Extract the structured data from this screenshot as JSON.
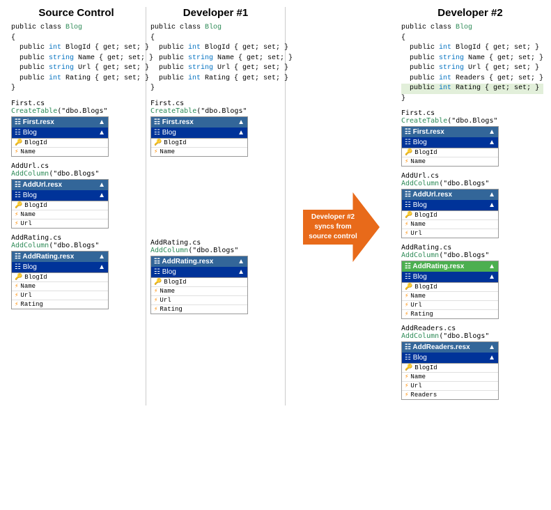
{
  "columns": {
    "source_control": {
      "title": "Source Control",
      "code": {
        "lines": [
          {
            "text": "public class Blog",
            "parts": [
              {
                "t": "public class ",
                "c": "black"
              },
              {
                "t": "Blog",
                "c": "teal"
              }
            ]
          },
          {
            "text": "{",
            "parts": [
              {
                "t": "{",
                "c": "black"
              }
            ]
          },
          {
            "text": "  public int BlogId { get; set; }",
            "parts": [
              {
                "t": "  public ",
                "c": "black"
              },
              {
                "t": "int",
                "c": "blue"
              },
              {
                "t": " BlogId { get; set; }",
                "c": "black"
              }
            ]
          },
          {
            "text": "  public string Name { get; set; }",
            "parts": [
              {
                "t": "  public ",
                "c": "black"
              },
              {
                "t": "string",
                "c": "blue"
              },
              {
                "t": " Name { get; set; }",
                "c": "black"
              }
            ]
          },
          {
            "text": "  public string Url { get; set; }",
            "parts": [
              {
                "t": "  public ",
                "c": "black"
              },
              {
                "t": "string",
                "c": "blue"
              },
              {
                "t": " Url { get; set; }",
                "c": "black"
              }
            ]
          },
          {
            "text": "  public int Rating { get; set; }",
            "parts": [
              {
                "t": "  public ",
                "c": "black"
              },
              {
                "t": "int",
                "c": "blue"
              },
              {
                "t": " Rating { get; set; }",
                "c": "black"
              }
            ]
          },
          {
            "text": "}",
            "parts": [
              {
                "t": "}",
                "c": "black"
              }
            ]
          }
        ]
      },
      "panels": [
        {
          "id": "first_cs",
          "filename": "First.cs",
          "createtable": "CreateTable(\"dbo.Blogs\"",
          "resx_label": "First.resx",
          "table_header": "Blog",
          "rows": [
            {
              "icon": "key",
              "label": "BlogId"
            },
            {
              "icon": "field",
              "label": "Name"
            }
          ]
        },
        {
          "id": "addurl_cs",
          "filename": "AddUrl.cs",
          "createtable": "AddColumn(\"dbo.Blogs\"",
          "resx_label": "AddUrl.resx",
          "table_header": "Blog",
          "rows": [
            {
              "icon": "key",
              "label": "BlogId"
            },
            {
              "icon": "field",
              "label": "Name"
            },
            {
              "icon": "field",
              "label": "Url"
            }
          ]
        },
        {
          "id": "addrating_cs",
          "filename": "AddRating.cs",
          "createtable": "AddColumn(\"dbo.Blogs\"",
          "resx_label": "AddRating.resx",
          "table_header": "Blog",
          "rows": [
            {
              "icon": "key",
              "label": "BlogId"
            },
            {
              "icon": "field",
              "label": "Name"
            },
            {
              "icon": "field",
              "label": "Url"
            },
            {
              "icon": "field",
              "label": "Rating"
            }
          ]
        }
      ]
    },
    "developer1": {
      "title": "Developer #1",
      "code": {
        "lines": [
          {
            "parts": [
              {
                "t": "public class ",
                "c": "black"
              },
              {
                "t": "Blog",
                "c": "teal"
              }
            ]
          },
          {
            "parts": [
              {
                "t": "{",
                "c": "black"
              }
            ]
          },
          {
            "parts": [
              {
                "t": "  public ",
                "c": "black"
              },
              {
                "t": "int",
                "c": "blue"
              },
              {
                "t": " BlogId { get; set; }",
                "c": "black"
              }
            ]
          },
          {
            "parts": [
              {
                "t": "  public ",
                "c": "black"
              },
              {
                "t": "string",
                "c": "blue"
              },
              {
                "t": " Name { get; set; }",
                "c": "black"
              }
            ]
          },
          {
            "parts": [
              {
                "t": "  public ",
                "c": "black"
              },
              {
                "t": "string",
                "c": "blue"
              },
              {
                "t": " Url { get; set; }",
                "c": "black"
              }
            ]
          },
          {
            "parts": [
              {
                "t": "  public ",
                "c": "black"
              },
              {
                "t": "int",
                "c": "blue"
              },
              {
                "t": " Rating { get; set; }",
                "c": "black"
              }
            ]
          },
          {
            "parts": [
              {
                "t": "}",
                "c": "black"
              }
            ]
          }
        ]
      },
      "panels": [
        {
          "id": "first_cs",
          "filename": "First.cs",
          "createtable": "CreateTable(\"dbo.Blogs\"",
          "resx_label": "First.resx",
          "table_header": "Blog",
          "rows": [
            {
              "icon": "key",
              "label": "BlogId"
            },
            {
              "icon": "field",
              "label": "Name"
            }
          ]
        },
        {
          "id": "addrating_cs2",
          "filename": "AddRating.cs",
          "createtable": "AddColumn(\"dbo.Blogs\"",
          "resx_label": "AddRating.resx",
          "table_header": "Blog",
          "rows": [
            {
              "icon": "key",
              "label": "BlogId"
            },
            {
              "icon": "field",
              "label": "Name"
            },
            {
              "icon": "field",
              "label": "Url"
            },
            {
              "icon": "field",
              "label": "Rating"
            }
          ]
        }
      ]
    },
    "developer2": {
      "title": "Developer #2",
      "code": {
        "lines": [
          {
            "parts": [
              {
                "t": "public class ",
                "c": "black"
              },
              {
                "t": "Blog",
                "c": "teal"
              }
            ]
          },
          {
            "parts": [
              {
                "t": "{",
                "c": "black"
              }
            ]
          },
          {
            "parts": [
              {
                "t": "  public ",
                "c": "black"
              },
              {
                "t": "int",
                "c": "blue"
              },
              {
                "t": " BlogId { get; set; }",
                "c": "black"
              }
            ]
          },
          {
            "parts": [
              {
                "t": "  public ",
                "c": "black"
              },
              {
                "t": "string",
                "c": "blue"
              },
              {
                "t": " Name { get; set; }",
                "c": "black"
              }
            ]
          },
          {
            "parts": [
              {
                "t": "  public ",
                "c": "black"
              },
              {
                "t": "string",
                "c": "blue"
              },
              {
                "t": " Url { get; set; }",
                "c": "black"
              }
            ]
          },
          {
            "parts": [
              {
                "t": "  public ",
                "c": "black"
              },
              {
                "t": "int",
                "c": "blue"
              },
              {
                "t": " Readers { get; set; }",
                "c": "black"
              }
            ]
          },
          {
            "parts": [
              {
                "t": "  public ",
                "c": "black"
              },
              {
                "t": "int",
                "c": "blue"
              },
              {
                "t": " Rating { get; set; }",
                "c": "black",
                "highlight": true
              }
            ]
          },
          {
            "parts": [
              {
                "t": "}",
                "c": "black"
              }
            ]
          }
        ]
      },
      "panels": [
        {
          "id": "first_cs",
          "filename": "First.cs",
          "createtable": "CreateTable(\"dbo.Blogs\"",
          "resx_label": "First.resx",
          "table_header": "Blog",
          "rows": [
            {
              "icon": "key",
              "label": "BlogId"
            },
            {
              "icon": "field",
              "label": "Name"
            }
          ]
        },
        {
          "id": "addurl_cs2",
          "filename": "AddUrl.cs",
          "createtable": "AddColumn(\"dbo.Blogs\"",
          "resx_label": "AddUrl.resx",
          "table_header": "Blog",
          "rows": [
            {
              "icon": "key",
              "label": "BlogId"
            },
            {
              "icon": "field",
              "label": "Name"
            },
            {
              "icon": "field",
              "label": "Url"
            }
          ]
        },
        {
          "id": "addrating_cs3",
          "filename": "AddRating.cs",
          "createtable": "AddColumn(\"dbo.Blogs\"",
          "resx_label": "AddRating.resx",
          "resx_header_green": true,
          "table_header": "Blog",
          "rows": [
            {
              "icon": "key",
              "label": "BlogId"
            },
            {
              "icon": "field",
              "label": "Name"
            },
            {
              "icon": "field",
              "label": "Url"
            },
            {
              "icon": "field",
              "label": "Rating"
            }
          ]
        },
        {
          "id": "addreaders_cs",
          "filename": "AddReaders.cs",
          "createtable": "AddColumn(\"dbo.Blogs\"",
          "resx_label": "AddReaders.resx",
          "table_header": "Blog",
          "rows": [
            {
              "icon": "key",
              "label": "BlogId"
            },
            {
              "icon": "field",
              "label": "Name"
            },
            {
              "icon": "field",
              "label": "Url"
            },
            {
              "icon": "field",
              "label": "Readers"
            }
          ]
        }
      ]
    }
  },
  "arrow": {
    "text": "Developer #2\nsyncs from\nsource control"
  },
  "icons": {
    "key": "🔑",
    "field": "⚡",
    "sort_asc": "▲",
    "table": "⊞"
  }
}
